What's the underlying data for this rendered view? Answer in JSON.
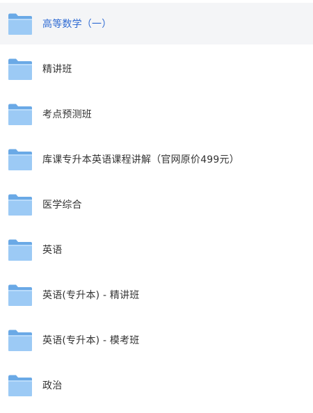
{
  "folders": [
    {
      "name": "高等数学（一）",
      "selected": true
    },
    {
      "name": "精讲班",
      "selected": false
    },
    {
      "name": "考点预测班",
      "selected": false
    },
    {
      "name": "库课专升本英语课程讲解（官网原价499元）",
      "selected": false
    },
    {
      "name": "医学综合",
      "selected": false
    },
    {
      "name": "英语",
      "selected": false
    },
    {
      "name": "英语(专升本) - 精讲班",
      "selected": false
    },
    {
      "name": "英语(专升本) - 模考班",
      "selected": false
    },
    {
      "name": "政治",
      "selected": false
    }
  ],
  "icon": "folder-icon",
  "colors": {
    "selected_text": "#2f6bd3",
    "text": "#333333",
    "selected_background": "#f4f5f7",
    "folder_back": "#6aa9e6",
    "folder_front": "#9ccaf5"
  }
}
